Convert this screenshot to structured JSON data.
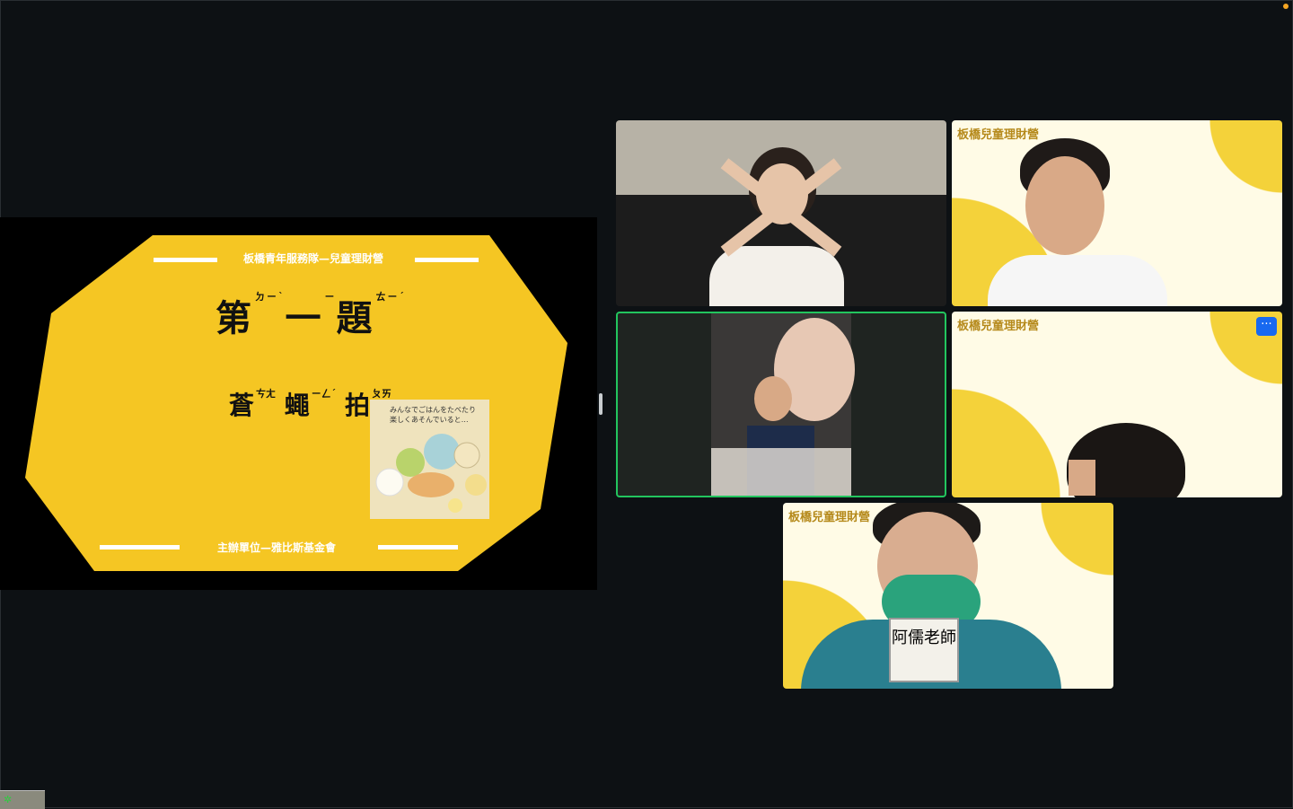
{
  "share": {
    "header": "板橋青年服務隊—兒童理財營",
    "title": "第",
    "title_zy1": "ㄉㄧˋ",
    "title_mid": "一",
    "title_zy2": "ㄧ",
    "title_end": "題",
    "title_zy3": "ㄊㄧˊ",
    "word1": "蒼",
    "word1_zy": "ㄘㄤ",
    "word2": "蠅",
    "word2_zy": "ㄧㄥˊ",
    "word3": "拍",
    "word3_zy": "ㄆㄞ",
    "illus_caption_1": "みんなでごはんをたべたり",
    "illus_caption_2": "楽しくあそんでいると…",
    "footer": "主辦單位—雅比斯基金會"
  },
  "tiles": {
    "vb_label": "板橋兒童理財營",
    "more_label": "···",
    "badge_text": "阿儒老師"
  },
  "colors": {
    "slide_yellow": "#f5c623",
    "active_border": "#22c55e",
    "more_button": "#1769f0"
  }
}
